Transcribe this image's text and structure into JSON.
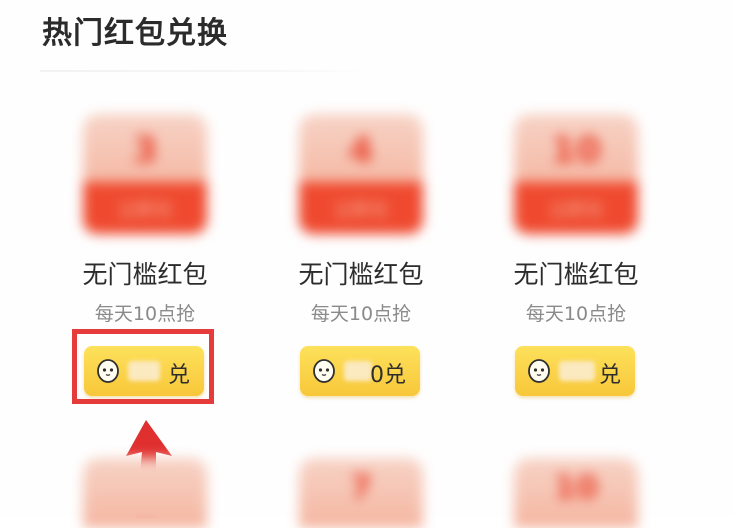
{
  "section": {
    "title": "热门红包兑换"
  },
  "cards": [
    {
      "packet_amount": "3",
      "packet_caption": "立即兑",
      "name": "无门槛红包",
      "subtitle": "每天10点抢",
      "button_masked_text": "",
      "button_label": "兑"
    },
    {
      "packet_amount": "4",
      "packet_caption": "立即兑",
      "name": "无门槛红包",
      "subtitle": "每天10点抢",
      "button_masked_text": "",
      "button_label": "0兑"
    },
    {
      "packet_amount": "10",
      "packet_caption": "立即兑",
      "name": "无门槛红包",
      "subtitle": "每天10点抢",
      "button_masked_text": "",
      "button_label": "兑"
    }
  ],
  "next_row": [
    {
      "packet_amount": ""
    },
    {
      "packet_amount": "7"
    },
    {
      "packet_amount": "10"
    }
  ],
  "colors": {
    "packet_red": "#ef4a2f",
    "button_yellow": "#fde15b",
    "highlight_red": "#e53b3b",
    "arrow_red": "#e02f2f"
  },
  "icons": {
    "coin": "coin-icon",
    "arrow": "arrow-up-icon"
  }
}
